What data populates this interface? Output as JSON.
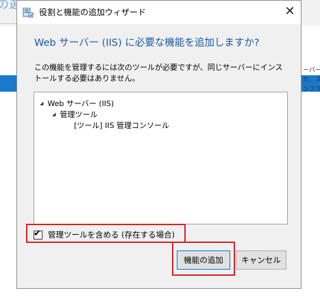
{
  "background": {
    "title_fragment": "の選択",
    "right_texts": [
      "ーバー",
      "た、スク",
      "ンフラ"
    ]
  },
  "dialog": {
    "title": "役割と機能の追加ウィザード",
    "close_glyph": "✕",
    "heading": "Web サーバー (IIS) に必要な機能を追加しますか?",
    "description": "この機能を管理するには次のツールが必要ですが、同じサーバーにインストールする必要はありません。",
    "tree": [
      {
        "label": "Web サーバー (IIS)",
        "expanded": true
      },
      {
        "label": "管理ツール",
        "expanded": true
      },
      {
        "label": "[ツール] IIS 管理コンソール",
        "expanded": false
      }
    ],
    "include_tools": {
      "label": "管理ツールを含める (存在する場合)",
      "checked": true
    },
    "buttons": {
      "add": "機能の追加",
      "cancel": "キャンセル"
    },
    "accent_color": "#1e5aa0",
    "highlight_color": "#d42323"
  }
}
